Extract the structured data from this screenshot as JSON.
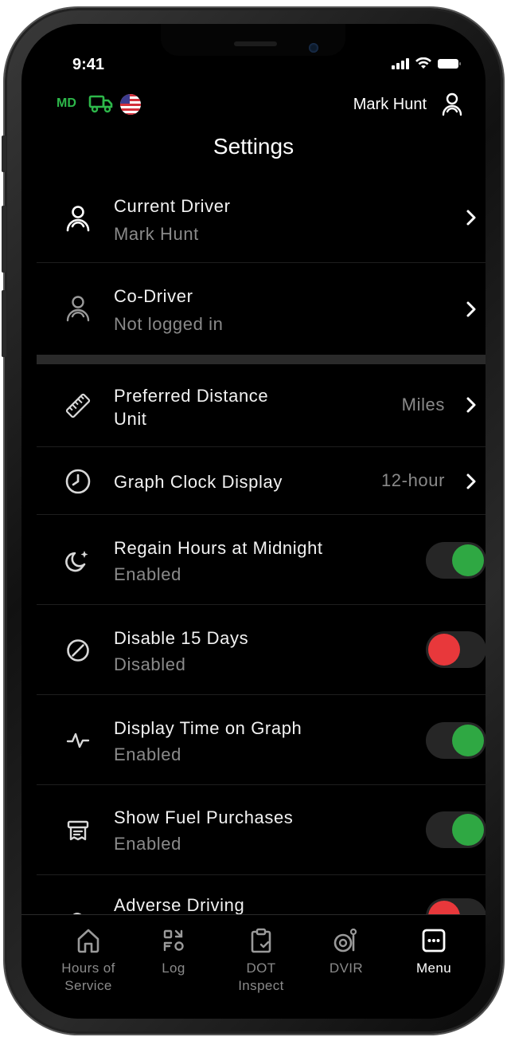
{
  "status": {
    "time": "9:41"
  },
  "header": {
    "jurisdiction": "MD",
    "user_name": "Mark Hunt",
    "title": "Settings"
  },
  "settings": {
    "current_driver": {
      "label": "Current Driver",
      "value": "Mark Hunt"
    },
    "co_driver": {
      "label": "Co-Driver",
      "value": "Not logged in"
    },
    "distance_unit": {
      "label_line1": "Preferred Distance",
      "label_line2": "Unit",
      "value": "Miles"
    },
    "graph_clock": {
      "label": "Graph Clock Display",
      "value": "12-hour"
    },
    "regain_hours": {
      "label": "Regain Hours at Midnight",
      "status": "Enabled",
      "on": true
    },
    "disable_15_days": {
      "label": "Disable 15 Days",
      "status": "Disabled",
      "on": false
    },
    "display_time_graph": {
      "label": "Display Time on Graph",
      "status": "Enabled",
      "on": true
    },
    "show_fuel": {
      "label": "Show Fuel Purchases",
      "status": "Enabled",
      "on": true
    },
    "adverse_driving": {
      "label": "Adverse Driving",
      "on": false
    }
  },
  "tabs": [
    {
      "line1": "Hours of",
      "line2": "Service",
      "icon": "home-icon"
    },
    {
      "line1": "Log",
      "line2": "",
      "icon": "log-icon"
    },
    {
      "line1": "DOT",
      "line2": "Inspect",
      "icon": "clipboard-icon"
    },
    {
      "line1": "DVIR",
      "line2": "",
      "icon": "dvir-icon"
    },
    {
      "line1": "Menu",
      "line2": "",
      "icon": "menu-icon",
      "active": true
    }
  ],
  "colors": {
    "green": "#2fa843",
    "red": "#e8383b",
    "badge_green": "#2db84a"
  }
}
